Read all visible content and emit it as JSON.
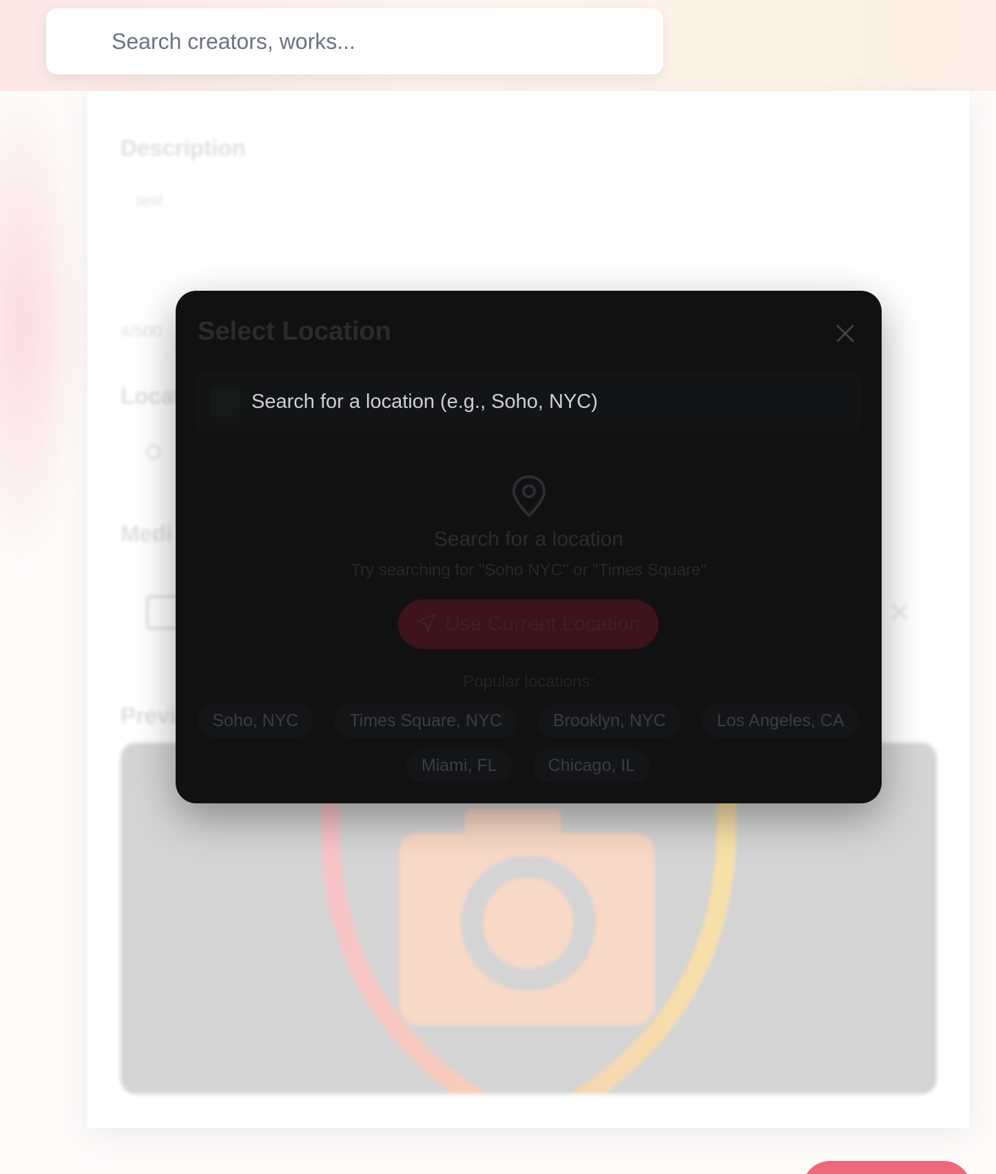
{
  "header": {
    "search_placeholder": "Search creators, works..."
  },
  "background_form": {
    "description_label": "Description",
    "description_value": "test",
    "char_count": "4/500",
    "location_label": "Locat",
    "media_label": "Medi",
    "preview_label": "Previ"
  },
  "modal": {
    "title": "Select Location",
    "search_placeholder": "Search for a location (e.g., Soho, NYC)",
    "empty_title": "Search for a location",
    "empty_subtitle": "Try searching for \"Soho NYC\" or \"Times Square\"",
    "use_current_label": "Use Current Location",
    "popular_label": "Popular locations:",
    "popular_locations": [
      "Soho, NYC",
      "Times Square, NYC",
      "Brooklyn, NYC",
      "Los Angeles, CA",
      "Miami, FL",
      "Chicago, IL"
    ]
  },
  "colors": {
    "accent": "#ea6a7c",
    "modal_bg": "#111112"
  },
  "icons": {
    "close": "close-icon",
    "pin": "map-pin-icon",
    "navigate": "navigation-arrow-icon",
    "image": "image-icon",
    "camera": "camera-icon"
  }
}
